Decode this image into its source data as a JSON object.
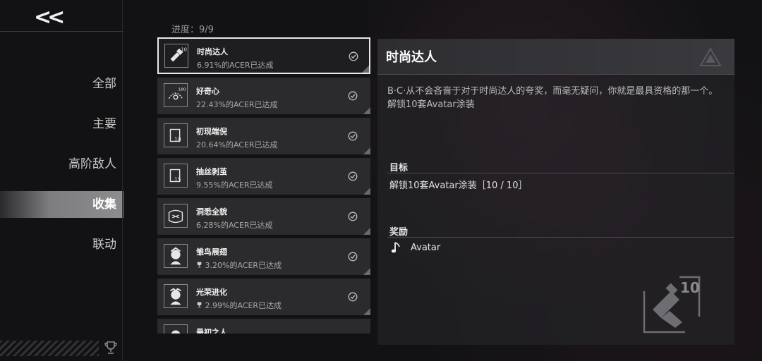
{
  "nav": {
    "back_label": "<<"
  },
  "sidebar": {
    "items": [
      {
        "label": "全部",
        "active": false
      },
      {
        "label": "主要",
        "active": false
      },
      {
        "label": "高阶敌人",
        "active": false
      },
      {
        "label": "收集",
        "active": true
      },
      {
        "label": "联动",
        "active": false
      }
    ]
  },
  "progress": {
    "label": "进度：9/9"
  },
  "achievements": [
    {
      "title": "时尚达人",
      "percent": "6.91%的ACER已达成",
      "icon": "brush-10-icon",
      "selected": true
    },
    {
      "title": "好奇心",
      "percent": "22.43%的ACER已达成",
      "icon": "curiosity-180-icon"
    },
    {
      "title": "初现端倪",
      "percent": "20.64%的ACER已达成",
      "icon": "card-10-icon"
    },
    {
      "title": "抽丝剥茧",
      "percent": "9.55%的ACER已达成",
      "icon": "card-15-icon"
    },
    {
      "title": "洞悉全貌",
      "percent": "6.28%的ACER已达成",
      "icon": "scroll-icon"
    },
    {
      "title": "雏鸟展翅",
      "percent": "3.20%的ACER已达成",
      "icon": "character-icon"
    },
    {
      "title": "光荣进化",
      "percent": "2.99%的ACER已达成",
      "icon": "character-icon"
    },
    {
      "title": "最初之人",
      "percent": "",
      "icon": "character-icon"
    }
  ],
  "detail": {
    "title": "时尚达人",
    "description": "B·C·从不会吝啬于对于时尚达人的夸奖，而毫无疑问，你就是最具资格的那一个。解锁10套Avatar涂装",
    "goal_header": "目标",
    "goal_text": "解锁10套Avatar涂装［10 / 10］",
    "reward_header": "奖励",
    "reward_text": "Avatar"
  }
}
